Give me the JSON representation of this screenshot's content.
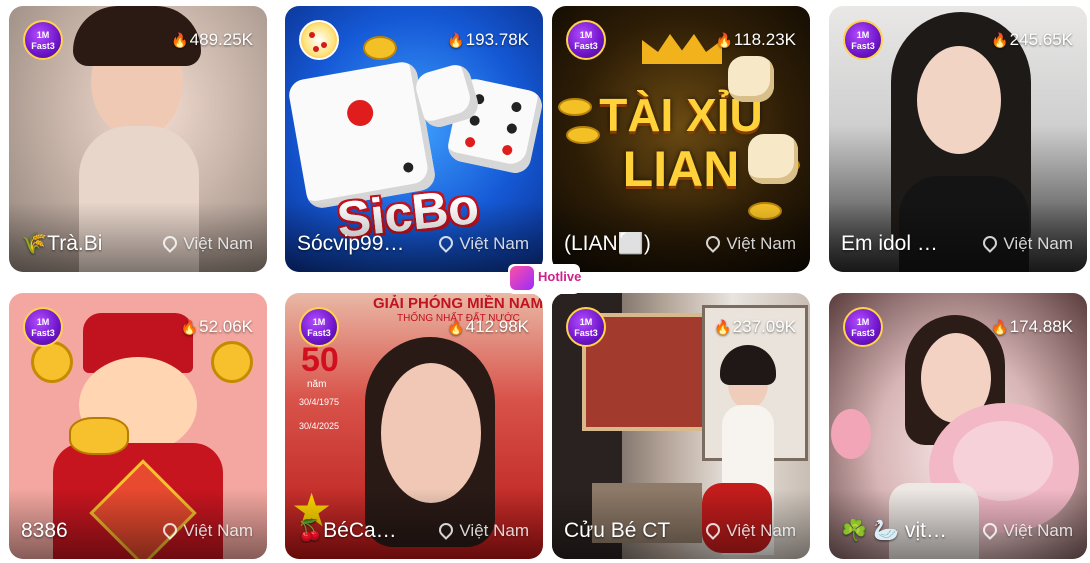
{
  "live_grid": {
    "cards": [
      {
        "name": "🌾Trà.Bi",
        "viewers": "489.25K",
        "location": "Việt Nam",
        "badge_top": "1M",
        "badge_bottom": "Fast3"
      },
      {
        "name": "Sócvip99…",
        "viewers": "193.78K",
        "location": "Việt Nam",
        "art_text": "SicBo"
      },
      {
        "name": "(LIAN⬜)",
        "viewers": "118.23K",
        "location": "Việt Nam",
        "badge_top": "1M",
        "badge_bottom": "Fast3",
        "art_text_line1": "TÀI XỈU",
        "art_text_line2": "LIAN"
      },
      {
        "name": "Em idol …",
        "viewers": "245.65K",
        "location": "Việt Nam",
        "badge_top": "1M",
        "badge_bottom": "Fast3"
      },
      {
        "name": "8386",
        "viewers": "52.06K",
        "location": "Việt Nam",
        "badge_top": "1M",
        "badge_bottom": "Fast3"
      },
      {
        "name": "🍒BéCa…",
        "viewers": "412.98K",
        "location": "Việt Nam",
        "badge_top": "1M",
        "badge_bottom": "Fast3",
        "art_text_line1": "GIẢI PHÓNG MIỀN NAM",
        "art_text_line2": "THỐNG NHẤT ĐẤT NƯỚC",
        "art_years": "50",
        "art_years_unit": "năm",
        "art_date_1": "30/4/1975",
        "art_date_2": "30/4/2025"
      },
      {
        "name": "Cửu Bé CT",
        "viewers": "237.09K",
        "location": "Việt Nam",
        "badge_top": "1M",
        "badge_bottom": "Fast3"
      },
      {
        "name": "☘️ 🦢 vịt…",
        "viewers": "174.88K",
        "location": "Việt Nam",
        "badge_top": "1M",
        "badge_bottom": "Fast3"
      }
    ]
  },
  "watermark": {
    "label": "Hotlive"
  },
  "colors": {
    "accent": "#ff5a1f",
    "badge": "#6e15c9",
    "badge_border": "#ffd24a"
  }
}
